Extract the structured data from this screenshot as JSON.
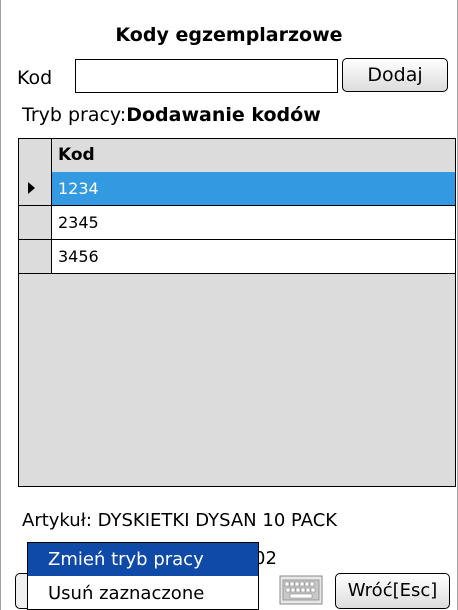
{
  "window": {
    "title": "Kody egzemplarzowe"
  },
  "form": {
    "code_label": "Kod",
    "code_value": "",
    "add_button": "Dodaj",
    "mode_label": "Tryb pracy:",
    "mode_value": "Dodawanie kodów"
  },
  "grid": {
    "column_header": "Kod",
    "rows": [
      {
        "code": "1234",
        "selected": true
      },
      {
        "code": "2345",
        "selected": false
      },
      {
        "code": "3456",
        "selected": false
      }
    ]
  },
  "article": {
    "label": "Artykuł:",
    "name": "DYSKIETKI DYSAN 10 PACK",
    "extra_visible": "02"
  },
  "menu": {
    "items": [
      "Zmień tryb pracy",
      "Usuń zaznaczone"
    ],
    "highlighted": "Zmień tryb pracy"
  },
  "footer": {
    "back_button": "Wróć[Esc]",
    "keyboard_icon": "keyboard-icon"
  },
  "colors": {
    "selection": "#3399e0",
    "menu_highlight": "#0f4aa8",
    "grid_background": "#dcdcdc"
  }
}
